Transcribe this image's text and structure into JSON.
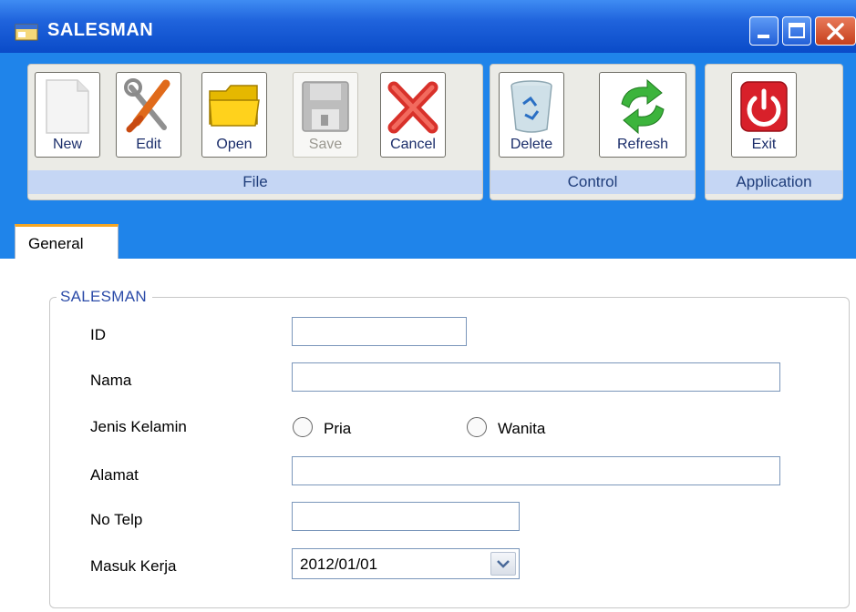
{
  "window": {
    "title": "SALESMAN"
  },
  "toolbar": {
    "groups": [
      {
        "label": "File",
        "buttons": [
          {
            "label": "New",
            "icon": "new-document-icon",
            "enabled": true
          },
          {
            "label": "Edit",
            "icon": "tools-icon",
            "enabled": true
          },
          {
            "label": "Open",
            "icon": "folder-icon",
            "enabled": true
          },
          {
            "label": "Save",
            "icon": "floppy-disk-icon",
            "enabled": false
          },
          {
            "label": "Cancel",
            "icon": "red-x-icon",
            "enabled": true
          }
        ]
      },
      {
        "label": "Control",
        "buttons": [
          {
            "label": "Delete",
            "icon": "recycle-bin-icon",
            "enabled": true
          },
          {
            "label": "Refresh",
            "icon": "refresh-arrows-icon",
            "enabled": true
          }
        ]
      },
      {
        "label": "Application",
        "buttons": [
          {
            "label": "Exit",
            "icon": "power-icon",
            "enabled": true
          }
        ]
      }
    ]
  },
  "tabs": [
    {
      "label": "General",
      "active": true
    }
  ],
  "form": {
    "legend": "SALESMAN",
    "id": {
      "label": "ID",
      "value": ""
    },
    "nama": {
      "label": "Nama",
      "value": ""
    },
    "jenis_kelamin": {
      "label": "Jenis Kelamin",
      "options": [
        "Pria",
        "Wanita"
      ],
      "selected": null
    },
    "alamat": {
      "label": "Alamat",
      "value": ""
    },
    "no_telp": {
      "label": "No Telp",
      "value": ""
    },
    "masuk_kerja": {
      "label": "Masuk Kerja",
      "value": "2012/01/01"
    }
  },
  "colors": {
    "title_bar": "#0a4bc8",
    "ribbon": "#1f84ea",
    "group_label_bg": "#c5d6f4",
    "tab_accent": "#f5a623"
  }
}
